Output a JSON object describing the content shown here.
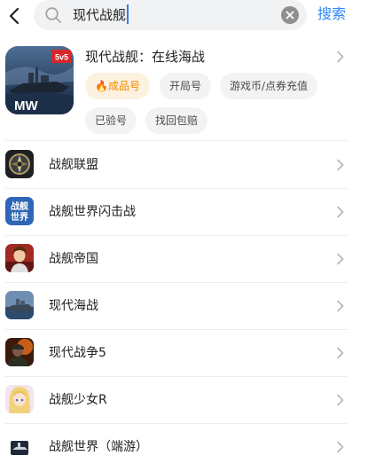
{
  "search": {
    "query": "现代战舰",
    "submit_label": "搜索"
  },
  "featured": {
    "title": "现代战舰：在线海战",
    "badge": "5v5",
    "logo_text": "MW",
    "hot_tag_icon": "🔥",
    "tags": [
      "成品号",
      "开局号",
      "游戏币/点券充值",
      "已验号",
      "找回包赔"
    ]
  },
  "results": [
    {
      "label": "战舰联盟",
      "icon": "compass-badge-icon"
    },
    {
      "label": "战舰世界闪击战",
      "icon": "text-logo-icon",
      "icon_text": "战舰世界"
    },
    {
      "label": "战舰帝国",
      "icon": "portrait-icon"
    },
    {
      "label": "现代海战",
      "icon": "warship-icon"
    },
    {
      "label": "现代战争5",
      "icon": "soldier-icon"
    },
    {
      "label": "战舰少女R",
      "icon": "anime-girl-icon"
    },
    {
      "label": "战舰世界（端游）",
      "icon": "ship-emblem-icon"
    }
  ],
  "colors": {
    "accent": "#2e86f7",
    "hot_tag_bg": "#fdf1df",
    "hot_tag_text": "#f18a00",
    "tag_bg": "#f2f3f5"
  }
}
